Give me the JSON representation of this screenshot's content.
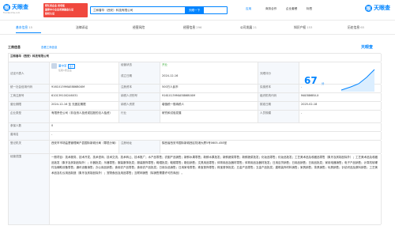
{
  "header": {
    "logo_text": "天眼查",
    "logo_sub": "TianYanCha.com",
    "promo_lines": [
      "帮忙找企业 找老板",
      "国家中小企业发展基金认证",
      "股权认证"
    ],
    "search_value": "兰和春华（西安）科技有限公司",
    "search_button": "天眼一下",
    "nav_items": [
      "应用",
      "商务合作",
      "企业套餐",
      "标签"
    ],
    "brand_top": "天眼查"
  },
  "tabs": [
    {
      "label": "基本信息",
      "count": "15"
    },
    {
      "label": "法律诉讼",
      "count": ""
    },
    {
      "label": "经营风险",
      "count": ""
    },
    {
      "label": "经营信息",
      "count": "296"
    },
    {
      "label": "公司发展",
      "count": "21"
    },
    {
      "label": "知识产权",
      "count": "153"
    },
    {
      "label": "历史信息",
      "count": "65"
    }
  ],
  "section": {
    "title": "工商信息",
    "link": "查看工商信息",
    "brand": "天眼查"
  },
  "info": {
    "company_name": "兰和春华（西安）科技有限公司",
    "legal_rep_label": "法定代表人",
    "legal_rep_name": "董中军",
    "legal_rep_tag": "法人",
    "legal_rep_sub": "任职1家企业",
    "status_label": "经营状态",
    "status_value": "开业",
    "founded_label": "成立日期",
    "founded_value": "2024-12-16",
    "score_label": "天眼评分",
    "score_value": "67",
    "score_unit": "分",
    "credit_label": "统一社会信用代码",
    "credit_value": "91610139MAE886B0XM",
    "capital_label": "注册资本",
    "capital_value": "500万人民币",
    "paid_label": "实缴资本",
    "paid_value": "-",
    "regno_label": "工商注册号",
    "regno_value": "610139100246031",
    "taxid_label": "纳税人识别号",
    "taxid_value": "91610139MAE886B0XM",
    "orgcode_label": "组织机构代码",
    "orgcode_value": "MAE886B0-X",
    "term_label": "营业期限",
    "term_value": "2024-12-16 至 无固定期限",
    "taxpayer_label": "纳税人资质",
    "taxpayer_value": "增值税一般纳税人",
    "approved_label": "核准日期",
    "approved_value": "2025-02-18",
    "type_label": "企业类型",
    "type_value": "有限责任公司（非自然人投资或控股的法人独资）",
    "industry_label": "行业",
    "industry_value": "研究和试验发展",
    "staff_label": "人员规模",
    "staff_value": "-",
    "insured_label": "参保人数",
    "insured_value": "0",
    "formername_label": "曾用名",
    "formername_value": "-",
    "authority_label": "登记机关",
    "authority_value": "西安市市场监督管理局户县国际新城分局（鄠邑分局）",
    "address_label": "注册地址",
    "address_value": "陕西省西安市国际新城西区陆港大厦5号0605-458室",
    "scope_label": "经营范围",
    "scope_value": "一般项目：技术服务、技术开发、技术咨询、技术交流、技术转让、技术推广；水产品零售；农副产品销售；新鲜水果零售；新鲜水果批发；新鲜蔬菜零售；新鲜蔬菜批发；化妆品零售；化妆品批发；工艺美术品及收藏品零售（象牙及其制品除外）；工艺美术品及收藏品批发（象牙及其制品除外）；乐器批发；乐器零售；服装服饰批发；服装服饰零售；鞋帽批发；鞋帽零售；箱包销售；文具用品零售；体育用品及器材零售；体育用品及器材批发；日用百货销售；日用品销售；日用品批发；家用电器销售；电子产品销售；计算机软硬件及辅助设备零售；通讯设备销售；办公用品销售；食用农产品零售；食用农产品批发；日用杂品销售；日用家电零售；珠宝首饰零售；珠宝首饰批发；五金产品零售；五金产品批发；建筑装饰材料销售；家具销售；茶具销售；玩具销售；针纺织品及原料销售；工艺美术品及礼仪用品制造（象牙及其制品除外）；宠物食品及用品零售；互联网销售（除销售需要许可的商品）。"
  },
  "colors": {
    "brand_blue": "#0084ff",
    "promo_red": "#f0483e",
    "label_bg": "#f5f8fc",
    "status_green": "#3dac3d"
  },
  "icons": {
    "logo": "tianyancha-logo-icon",
    "search_clear": "clear-icon",
    "trend": "score-trend-chart"
  }
}
